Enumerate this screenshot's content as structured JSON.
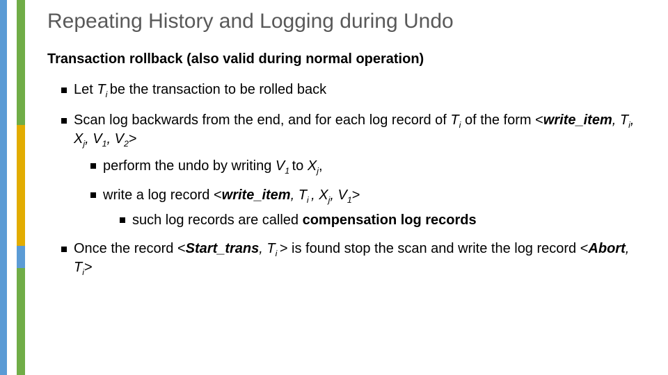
{
  "title": "Repeating History and Logging during Undo",
  "lead": "Transaction rollback (also valid during normal operation)",
  "b1_a": "Let ",
  "b1_T": "T",
  "b1_i": "i ",
  "b1_b": "be the transaction to be rolled back",
  "b2_a": "Scan log backwards from the end, and for each log record of ",
  "b2_T": "T",
  "b2_i": "i",
  "b2_b": " of the form <",
  "b2_kw": "write_item",
  "b2_c": ", ",
  "b2_T2": "T",
  "b2_i2": "i",
  "b2_d": ", ",
  "b2_X": "X",
  "b2_j": "j",
  "b2_e": ",  ",
  "b2_V": "V",
  "b2_1": "1",
  "b2_f": ",  ",
  "b2_V2": "V",
  "b2_2": "2",
  "b2_g": ">",
  "b2s1_a": "perform the undo by writing ",
  "b2s1_V": "V",
  "b2s1_1": "1 ",
  "b2s1_b": "to ",
  "b2s1_X": "X",
  "b2s1_j": "j",
  "b2s1_c": ",",
  "b2s2_a": "write a log record <",
  "b2s2_kw": "write_item",
  "b2s2_b": ", ",
  "b2s2_T": "T",
  "b2s2_i": "i ",
  "b2s2_c": ", ",
  "b2s2_X": "X",
  "b2s2_j": "j",
  "b2s2_d": ",  ",
  "b2s2_V": "V",
  "b2s2_1": "1",
  "b2s2_e": ">",
  "b2s3_a": "such log records are called ",
  "b2s3_term": "compensation log records",
  "b3_a": "Once the record <",
  "b3_kw": "Start_trans",
  "b3_b": ", ",
  "b3_T": "T",
  "b3_i": "i ",
  "b3_c": "> is found stop the scan and write the log record <",
  "b3_kw2": "Abort",
  "b3_d": ", ",
  "b3_T2": "T",
  "b3_i2": "i",
  "b3_e": ">"
}
